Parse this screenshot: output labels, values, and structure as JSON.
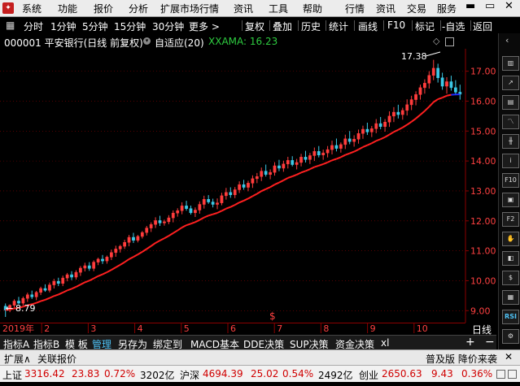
{
  "menu": [
    "系统",
    "功能",
    "报价",
    "分析",
    "扩展市场行情",
    "资讯",
    "工具",
    "帮助"
  ],
  "menu_right": [
    "行情",
    "资讯",
    "交易",
    "服务"
  ],
  "toolbar": {
    "periods": [
      "分时",
      "1分钟",
      "5分钟",
      "15分钟",
      "30分钟",
      "更多 >"
    ],
    "buttons": [
      "复权",
      "叠加",
      "历史",
      "统计",
      "画线",
      "F10",
      "标记",
      "-自选",
      "返回"
    ]
  },
  "chart_title": {
    "code_name": "000001 平安银行(日线 前复权)",
    "indicator": "自适应(20)",
    "indicator_value": "XXAMA: 16.23"
  },
  "colors": {
    "up": "#ff3c3c",
    "down": "#3cc8e6",
    "ama_up": "#ff2020",
    "ama_flat": "#1e2cff",
    "ama_down": "#28d228",
    "axis_price": "#ff4040",
    "grid": "#8b0000"
  },
  "price_axis": [
    "17.00",
    "16.00",
    "15.00",
    "14.00",
    "13.00",
    "12.00",
    "11.00",
    "10.00",
    "9.00"
  ],
  "annotations": {
    "high": "17.38",
    "low": "8.79",
    "ex_rights_mark": "$"
  },
  "x_axis": {
    "year_label": "2019年",
    "months": [
      "2",
      "3",
      "4",
      "5",
      "6",
      "7",
      "8",
      "9",
      "10"
    ],
    "period": "日线"
  },
  "chart_data": {
    "type": "candlestick",
    "ylim": [
      8.6,
      17.75
    ],
    "ohlc": [
      [
        9.15,
        9.24,
        8.79,
        9.02
      ],
      [
        9.02,
        9.21,
        8.95,
        9.18
      ],
      [
        9.18,
        9.38,
        9.1,
        9.32
      ],
      [
        9.32,
        9.46,
        9.21,
        9.25
      ],
      [
        9.25,
        9.47,
        9.17,
        9.41
      ],
      [
        9.41,
        9.6,
        9.29,
        9.53
      ],
      [
        9.53,
        9.67,
        9.39,
        9.46
      ],
      [
        9.46,
        9.66,
        9.35,
        9.61
      ],
      [
        9.61,
        9.8,
        9.52,
        9.74
      ],
      [
        9.74,
        9.88,
        9.63,
        9.68
      ],
      [
        9.68,
        9.94,
        9.61,
        9.86
      ],
      [
        9.86,
        10.06,
        9.74,
        9.98
      ],
      [
        9.98,
        10.1,
        9.82,
        9.91
      ],
      [
        9.91,
        10.17,
        9.82,
        10.09
      ],
      [
        10.09,
        10.26,
        9.98,
        10.2
      ],
      [
        10.2,
        10.32,
        10.02,
        10.12
      ],
      [
        10.12,
        10.35,
        10.04,
        10.28
      ],
      [
        10.28,
        10.49,
        10.16,
        10.42
      ],
      [
        10.42,
        10.6,
        10.31,
        10.5
      ],
      [
        10.5,
        10.62,
        10.33,
        10.41
      ],
      [
        10.41,
        10.68,
        10.32,
        10.62
      ],
      [
        10.62,
        10.77,
        10.52,
        10.72
      ],
      [
        10.72,
        10.86,
        10.56,
        10.66
      ],
      [
        10.66,
        10.84,
        10.57,
        10.79
      ],
      [
        10.79,
        11.04,
        10.69,
        10.94
      ],
      [
        10.94,
        11.17,
        10.8,
        11.06
      ],
      [
        11.06,
        11.2,
        10.94,
        11.15
      ],
      [
        11.15,
        11.37,
        11.06,
        11.28
      ],
      [
        11.28,
        11.53,
        11.15,
        11.45
      ],
      [
        11.45,
        11.6,
        11.26,
        11.35
      ],
      [
        11.35,
        11.53,
        11.28,
        11.48
      ],
      [
        11.48,
        11.66,
        11.41,
        11.61
      ],
      [
        11.61,
        11.83,
        11.51,
        11.76
      ],
      [
        11.76,
        11.95,
        11.63,
        11.88
      ],
      [
        11.88,
        12.12,
        11.76,
        12.01
      ],
      [
        12.01,
        12.17,
        11.83,
        11.93
      ],
      [
        11.93,
        12.04,
        11.84,
        11.97
      ],
      [
        11.97,
        12.19,
        11.89,
        12.1
      ],
      [
        12.1,
        12.35,
        11.95,
        12.26
      ],
      [
        12.26,
        12.42,
        12.14,
        12.34
      ],
      [
        12.34,
        12.62,
        12.22,
        12.5
      ],
      [
        12.5,
        12.67,
        12.34,
        12.41
      ],
      [
        12.41,
        12.51,
        12.21,
        12.27
      ],
      [
        12.27,
        12.45,
        12.13,
        12.36
      ],
      [
        12.36,
        12.65,
        12.24,
        12.55
      ],
      [
        12.55,
        12.84,
        12.41,
        12.72
      ],
      [
        12.72,
        12.86,
        12.57,
        12.63
      ],
      [
        12.63,
        12.74,
        12.45,
        12.55
      ],
      [
        12.55,
        12.75,
        12.39,
        12.6
      ],
      [
        12.6,
        12.94,
        12.52,
        12.84
      ],
      [
        12.84,
        13.1,
        12.71,
        12.95
      ],
      [
        12.95,
        13.12,
        12.77,
        12.87
      ],
      [
        12.87,
        13.13,
        12.76,
        13.04
      ],
      [
        13.04,
        13.32,
        12.93,
        13.21
      ],
      [
        13.21,
        13.37,
        13.04,
        13.12
      ],
      [
        13.12,
        13.34,
        12.99,
        13.26
      ],
      [
        13.26,
        13.52,
        13.1,
        13.41
      ],
      [
        13.41,
        13.6,
        13.26,
        13.48
      ],
      [
        13.48,
        13.78,
        13.33,
        13.66
      ],
      [
        13.66,
        13.88,
        13.48,
        13.55
      ],
      [
        13.55,
        13.72,
        13.39,
        13.62
      ],
      [
        13.62,
        13.96,
        13.51,
        13.84
      ],
      [
        13.84,
        14.04,
        13.66,
        13.76
      ],
      [
        13.76,
        14.01,
        13.64,
        13.9
      ],
      [
        13.9,
        14.14,
        13.75,
        14.02
      ],
      [
        14.02,
        14.16,
        13.82,
        13.88
      ],
      [
        13.88,
        14.07,
        13.72,
        13.95
      ],
      [
        13.95,
        14.24,
        13.82,
        14.13
      ],
      [
        14.13,
        14.34,
        13.95,
        14.05
      ],
      [
        14.05,
        14.27,
        13.9,
        14.18
      ],
      [
        14.18,
        14.45,
        14.0,
        14.32
      ],
      [
        14.32,
        14.5,
        14.12,
        14.2
      ],
      [
        14.2,
        14.38,
        14.04,
        14.27
      ],
      [
        14.27,
        14.5,
        14.12,
        14.38
      ],
      [
        14.38,
        14.68,
        14.22,
        14.52
      ],
      [
        14.52,
        14.75,
        14.32,
        14.42
      ],
      [
        14.42,
        14.62,
        14.28,
        14.55
      ],
      [
        14.55,
        14.88,
        14.4,
        14.74
      ],
      [
        14.74,
        15.0,
        14.56,
        14.65
      ],
      [
        14.65,
        14.86,
        14.48,
        14.73
      ],
      [
        14.73,
        15.05,
        14.58,
        14.92
      ],
      [
        14.92,
        15.18,
        14.74,
        15.06
      ],
      [
        15.06,
        15.28,
        14.87,
        14.97
      ],
      [
        14.97,
        15.17,
        14.8,
        15.08
      ],
      [
        15.08,
        15.4,
        14.93,
        15.25
      ],
      [
        15.25,
        15.47,
        15.06,
        15.15
      ],
      [
        15.15,
        15.4,
        14.98,
        15.3
      ],
      [
        15.3,
        15.66,
        15.14,
        15.5
      ],
      [
        15.5,
        15.8,
        15.3,
        15.63
      ],
      [
        15.63,
        15.88,
        15.42,
        15.55
      ],
      [
        15.55,
        15.78,
        15.38,
        15.69
      ],
      [
        15.69,
        16.06,
        15.52,
        15.88
      ],
      [
        15.88,
        16.18,
        15.7,
        16.05
      ],
      [
        16.05,
        16.33,
        15.86,
        16.22
      ],
      [
        16.22,
        16.55,
        16.05,
        16.45
      ],
      [
        16.45,
        16.73,
        16.25,
        16.6
      ],
      [
        16.6,
        17.0,
        16.42,
        16.86
      ],
      [
        16.86,
        17.38,
        16.7,
        17.1
      ],
      [
        17.1,
        17.25,
        16.62,
        16.78
      ],
      [
        16.78,
        16.95,
        16.38,
        16.5
      ],
      [
        16.5,
        16.8,
        16.25,
        16.65
      ],
      [
        16.65,
        16.85,
        16.35,
        16.45
      ],
      [
        16.45,
        16.7,
        16.2,
        16.3
      ],
      [
        16.3,
        16.55,
        16.05,
        16.23
      ]
    ],
    "ama_segments": [
      {
        "trend": "down",
        "range": [
          0,
          3
        ]
      },
      {
        "trend": "up",
        "range": [
          3,
          105
        ]
      }
    ]
  },
  "bottom_tabs": [
    "指标A",
    "指标B",
    "模 板",
    "管理",
    "另存为",
    "绑定到",
    "MACD基本",
    "DDE决策",
    "SUP决策",
    "资金决策",
    "xl"
  ],
  "bottom_tabs_active": "管理",
  "right_buttons": [
    "F10",
    "F2",
    "RSI"
  ],
  "ext_bar": {
    "left": "扩展∧",
    "ticker_label": "关联报价",
    "right": "普及版 降价来袭"
  },
  "status": [
    {
      "name": "上证",
      "price": "3316.42",
      "change": "23.83",
      "pct": "0.72%",
      "amount": "3202亿"
    },
    {
      "name": "沪深",
      "price": "4694.39",
      "change": "25.02",
      "pct": "0.54%",
      "amount": "2492亿"
    },
    {
      "name": "创业",
      "price": "2650.63",
      "change": "9.43",
      "pct": "0.36%",
      "amount": ""
    }
  ]
}
